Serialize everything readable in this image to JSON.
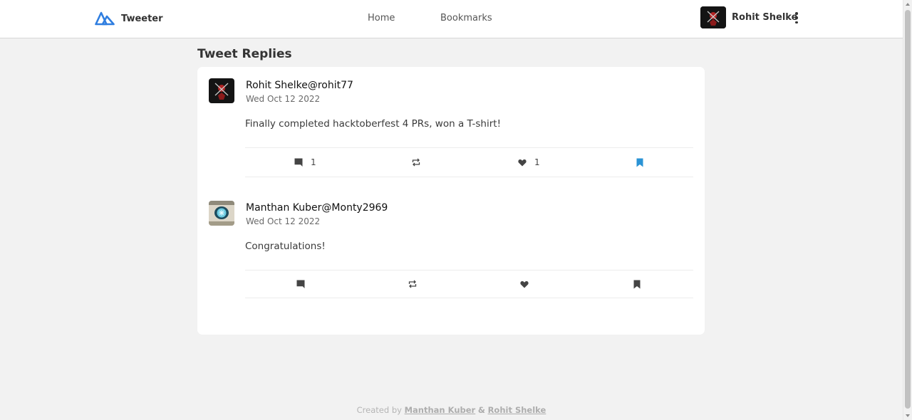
{
  "header": {
    "brand": "Tweeter",
    "nav": {
      "home": "Home",
      "bookmarks": "Bookmarks"
    },
    "user_name": "Rohit Shelke",
    "icons": {
      "logo": "logo-icon",
      "menu": "kebab-menu-icon"
    },
    "brand_color": "#2f7ee0"
  },
  "page_title": "Tweet Replies",
  "tweets": [
    {
      "author": "Rohit Shelke",
      "handle": "@rohit77",
      "date": "Wed Oct 12 2022",
      "text": "Finally completed hacktoberfest 4 PRs, won a T-shirt!",
      "reply_count": "1",
      "like_count": "1",
      "bookmarked": true
    },
    {
      "author": "Manthan Kuber",
      "handle": "@Monty2969",
      "date": "Wed Oct 12 2022",
      "text": "Congratulations!",
      "reply_count": "",
      "like_count": "",
      "bookmarked": false
    }
  ],
  "colors": {
    "bookmark_active": "#2a93d5",
    "icon_default": "#444444"
  },
  "footer": {
    "prefix": "Created by",
    "author1": "Manthan Kuber",
    "separator": "&",
    "author2": "Rohit Shelke"
  }
}
